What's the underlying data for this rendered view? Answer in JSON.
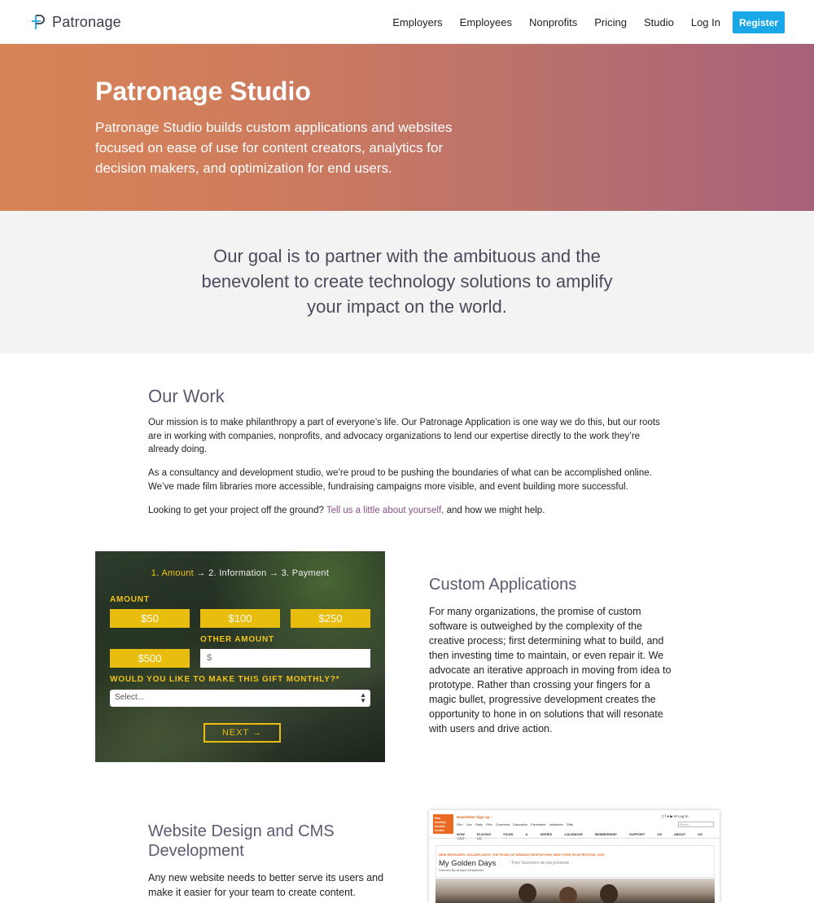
{
  "nav": {
    "brand": "Patronage",
    "links": [
      "Employers",
      "Employees",
      "Nonprofits",
      "Pricing",
      "Studio",
      "Log In"
    ],
    "register_label": "Register"
  },
  "hero": {
    "title": "Patronage Studio",
    "text": "Patronage Studio builds custom applications and websites focused on ease of use for content creators, analytics for decision makers, and optimization for end users."
  },
  "goal": {
    "text": "Our goal is to partner with the ambituous and the benevolent to create technology solutions to amplify your impact on the world."
  },
  "our_work": {
    "title": "Our Work",
    "p1": "Our mission is to make philanthropy a part of everyone’s life. Our Patronage Application is one way we do this, but our roots are in working with companies, nonprofits, and advocacy organizations to lend our expertise directly to the work they’re already doing.",
    "p2": "As a consultancy and development studio, we’re proud to be pushing the boundaries of what can be accomplished online. We’ve made film libraries more accessible, fundraising campaigns more visible, and event building more successful.",
    "p3_before": "Looking to get your project off the ground?",
    "p3_link": "Tell us a little about yourself,",
    "p3_after": "and how we might help."
  },
  "donation_form": {
    "step1": "1. Amount",
    "step2": "2. Information",
    "step3": "3. Payment",
    "arrow": "→",
    "amount_label": "AMOUNT",
    "amounts": [
      "$50",
      "$100",
      "$250",
      "$500"
    ],
    "other_amount_label": "OTHER AMOUNT",
    "other_amount_placeholder": "$",
    "monthly_label": "WOULD YOU LIKE TO MAKE THIS GIFT MONTHLY?*",
    "select_value": "Select...",
    "next_label": "NEXT →",
    "accent_color": "#e9bd0d"
  },
  "custom_apps": {
    "title": "Custom Applications",
    "text": "For many organizations, the promise of custom software is outweighed by the complexity of the creative process; first determining what to build, and then investing time to maintain, or even repair it. We advocate an iterative approach in moving from idea to prototype. Rather than crossing your fingers for a magic bullet, progressive development creates the opportunity to hone in on solutions that will resonate with users and drive action."
  },
  "website_design": {
    "title": "Website Design and CMS Development",
    "text": "Any new website needs to better serve its users and make it easier for your team to create content."
  },
  "film_society": {
    "logo_text": "film society lincoln center",
    "signup": "Newsletter Sign up ›",
    "sublinks": "Film Linc Daily   Film Comment   Education   Filmmaker Initiatives   Gifts",
    "nav": "NOW PLAYING   FILMS & SERIES   CALENDAR   MEMBERSHIP   SUPPORT US   ABOUT US   VISIT US",
    "login": "Log In",
    "search": "Search",
    "tag": "NEW RELEASES, GOLDEN DAYS: THE FILMS OF ARNAUD DESPLECHIN, NEW YORK FILM FESTIVAL 2015",
    "headline": "My Golden Days",
    "subtitle": "· Trois Souvenirs de ma jeunesse",
    "directed_by": "Directed By Arnaud Desplechin"
  },
  "colors": {
    "brand_blue": "#1aa7e8",
    "hero_start": "#d98456",
    "hero_end": "#a6617a",
    "link_purple": "#8b4f8a",
    "film_orange": "#ea6a21"
  }
}
